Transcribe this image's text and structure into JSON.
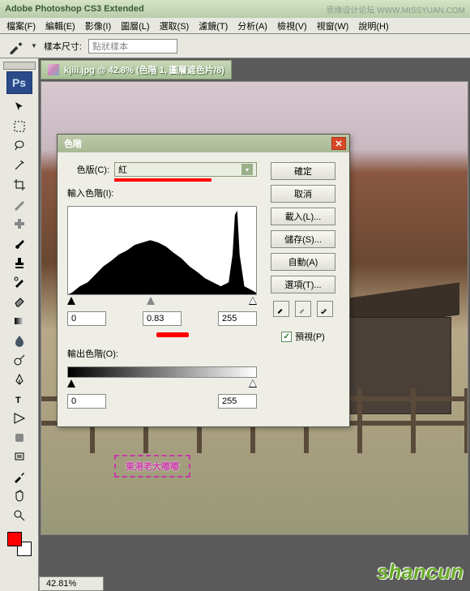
{
  "app": {
    "title": "Adobe Photoshop CS3 Extended",
    "watermark": "思缘设计论坛  WWW.MISSYUAN.COM"
  },
  "menu": {
    "file": "檔案(F)",
    "edit": "編輯(E)",
    "image": "影像(I)",
    "layer": "圖層(L)",
    "select": "選取(S)",
    "filter": "濾鏡(T)",
    "analysis": "分析(A)",
    "view": "檢視(V)",
    "window": "視窗(W)",
    "help": "說明(H)"
  },
  "options": {
    "sample_label": "樣本尺寸:",
    "sample_value": "點狀樣本"
  },
  "document": {
    "title": "kjili.jpg @ 42.8% (色階 1, 圖層遮色片/8)",
    "zoom": "42.81%"
  },
  "ps_badge": "Ps",
  "dialog": {
    "title": "色階",
    "channel_label": "色版(C):",
    "channel_value": "紅",
    "input_label": "輸入色階(I):",
    "output_label": "輸出色階(O):",
    "in_black": "0",
    "in_gamma": "0.83",
    "in_white": "255",
    "out_black": "0",
    "out_white": "255",
    "buttons": {
      "ok": "確定",
      "cancel": "取消",
      "load": "載入(L)...",
      "save": "儲存(S)...",
      "auto": "自動(A)",
      "options": "選項(T)..."
    },
    "preview_label": "預視(P)",
    "preview_checked": "✓"
  },
  "overlay_text": "東港老大嘟嘟",
  "shancun": "shancun"
}
